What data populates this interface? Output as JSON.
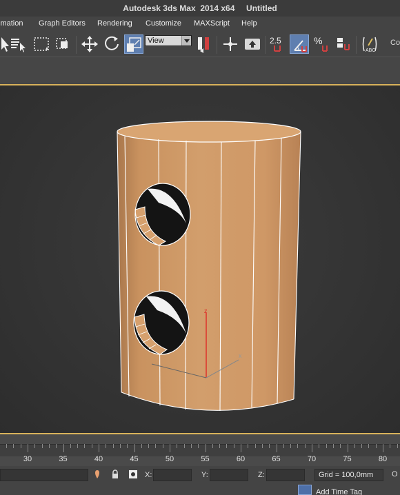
{
  "window": {
    "title": "Autodesk 3ds Max  2014 x64     Untitled"
  },
  "menu": {
    "items": [
      {
        "label": "imation"
      },
      {
        "label": "Graph Editors"
      },
      {
        "label": "Rendering"
      },
      {
        "label": "Customize"
      },
      {
        "label": "MAXScript"
      },
      {
        "label": "Help"
      }
    ]
  },
  "toolbar": {
    "reference_coord_value": "View",
    "angle_snap_label": "2.5",
    "cut_label": "Co"
  },
  "viewport": {
    "axis_z_label": "z",
    "axis_x_label": "x",
    "object_color": "#cc9766",
    "frame_color": "#d8b25a"
  },
  "timeline": {
    "ticks": [
      "30",
      "35",
      "40",
      "45",
      "50",
      "55",
      "60",
      "65",
      "70",
      "75",
      "80"
    ]
  },
  "status": {
    "x_label": "X:",
    "y_label": "Y:",
    "z_label": "Z:",
    "x_value": "",
    "y_value": "",
    "z_value": "",
    "grid": "Grid = 100,0mm",
    "add_time_tag": "Add Time Tag",
    "cut_label": "O"
  }
}
